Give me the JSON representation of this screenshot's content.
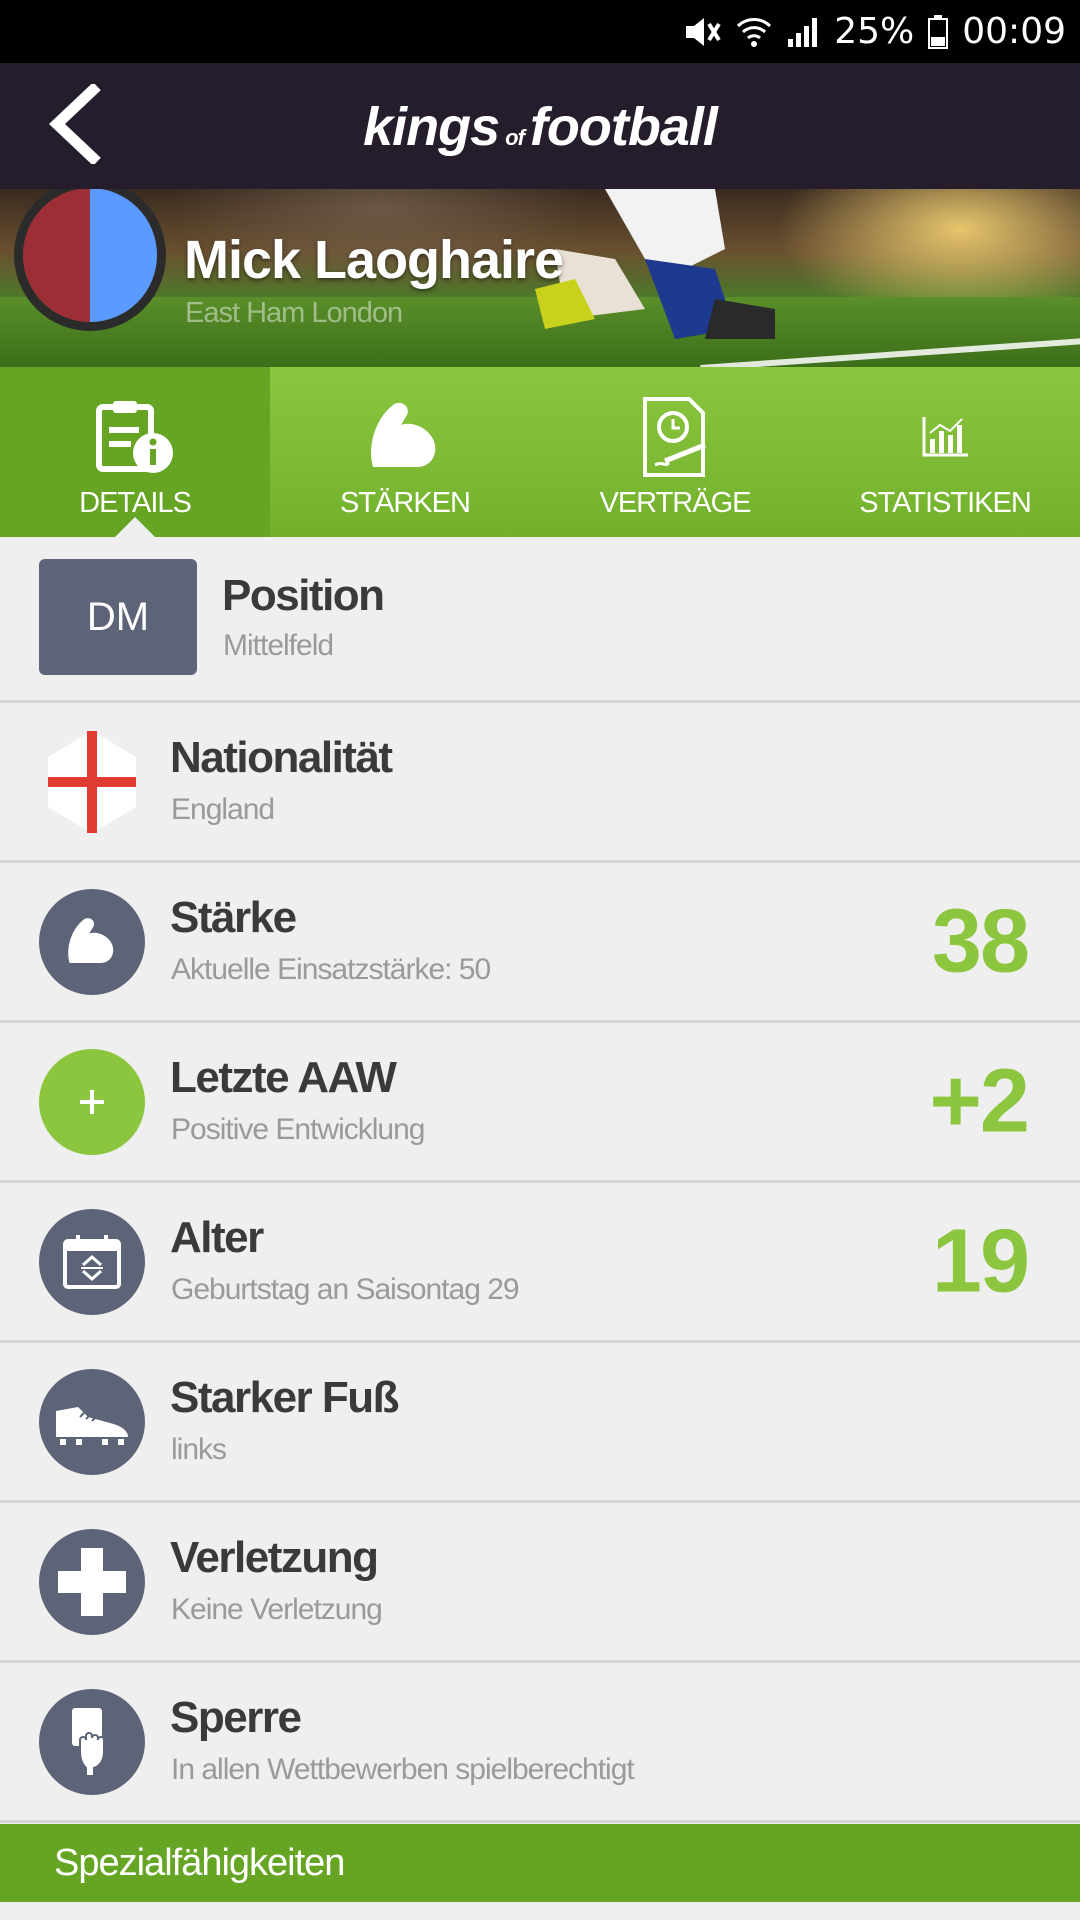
{
  "status_bar": {
    "battery_percent": "25%",
    "time": "00:09",
    "icons": [
      "mute-icon",
      "wifi-icon",
      "signal-icon",
      "battery-icon"
    ]
  },
  "header": {
    "logo_main_left": "kings",
    "logo_of": "of",
    "logo_main_right": "football",
    "back_icon": "chevron-left-icon"
  },
  "player": {
    "name": "Mick Laoghaire",
    "club": "East Ham London",
    "crest_colors": [
      "#9b2f35",
      "#5b9bff"
    ]
  },
  "tabs": [
    {
      "label": "DETAILS",
      "icon": "details-document-info-icon",
      "active": true
    },
    {
      "label": "STÄRKEN",
      "icon": "flexed-arm-icon",
      "active": false
    },
    {
      "label": "VERTRÄGE",
      "icon": "contract-clock-icon",
      "active": false
    },
    {
      "label": "STATISTIKEN",
      "icon": "bar-chart-icon",
      "active": false
    }
  ],
  "details": [
    {
      "title": "Position",
      "subtitle": "Mittelfeld",
      "badge": "DM"
    },
    {
      "title": "Nationalität",
      "subtitle": "England",
      "icon": "england-flag-icon"
    },
    {
      "title": "Stärke",
      "subtitle": "Aktuelle Einsatzstärke: 50",
      "value": "38",
      "icon": "flexed-arm-icon"
    },
    {
      "title": "Letzte AAW",
      "subtitle": "Positive Entwicklung",
      "value": "+2",
      "icon": "plus-icon"
    },
    {
      "title": "Alter",
      "subtitle": "Geburtstag an Saisontag 29",
      "value": "19",
      "icon": "calendar-icon"
    },
    {
      "title": "Starker Fuß",
      "subtitle": "links",
      "icon": "football-boot-icon"
    },
    {
      "title": "Verletzung",
      "subtitle": "Keine Verletzung",
      "icon": "medical-cross-icon"
    },
    {
      "title": "Sperre",
      "subtitle": "In allen Wettbewerben spielberechtigt",
      "icon": "card-hand-icon"
    }
  ],
  "section_header": "Spezialfähigkeiten",
  "colors": {
    "accent_green": "#8cc63f",
    "tab_active": "#65a523",
    "header_bg": "#251d2c",
    "icon_bg": "#5e6478"
  }
}
